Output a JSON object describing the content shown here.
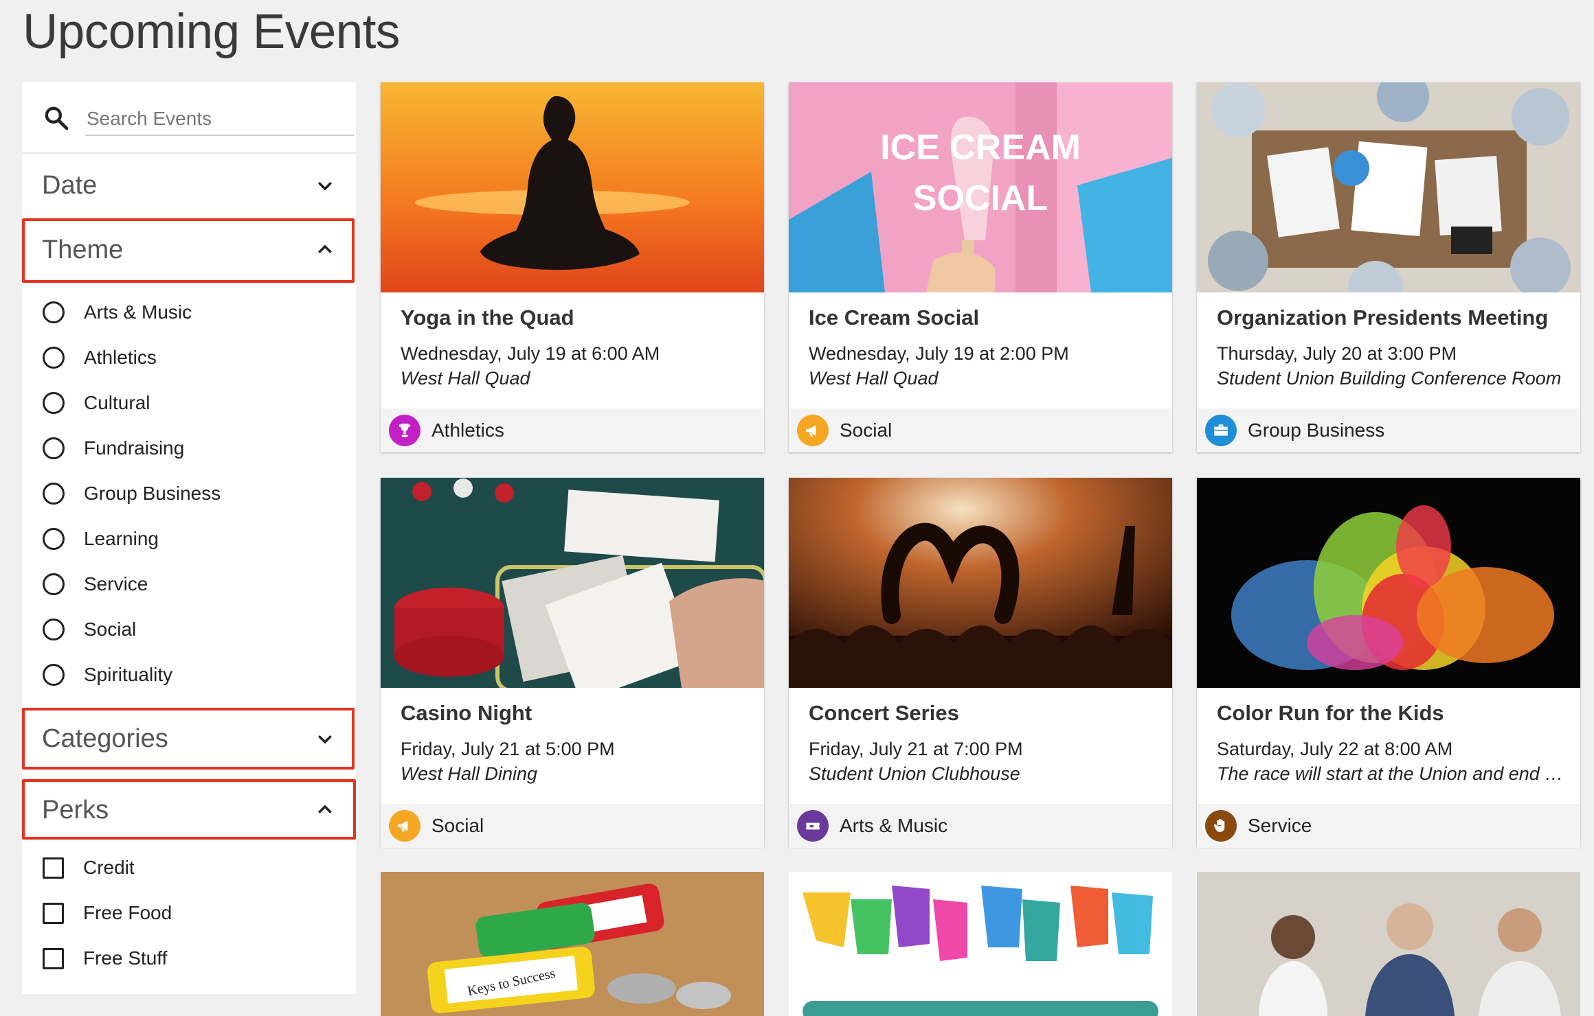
{
  "page": {
    "title": "Upcoming Events"
  },
  "search": {
    "placeholder": "Search Events",
    "value": ""
  },
  "filters": {
    "date": {
      "label": "Date",
      "expanded": false
    },
    "theme": {
      "label": "Theme",
      "expanded": true,
      "options": [
        "Arts & Music",
        "Athletics",
        "Cultural",
        "Fundraising",
        "Group Business",
        "Learning",
        "Service",
        "Social",
        "Spirituality"
      ]
    },
    "categories": {
      "label": "Categories",
      "expanded": false
    },
    "perks": {
      "label": "Perks",
      "expanded": true,
      "options": [
        "Credit",
        "Free Food",
        "Free Stuff"
      ]
    }
  },
  "colors": {
    "highlight": "#e53323",
    "athletics": "#c21fc4",
    "social": "#f5a623",
    "group_business": "#1e8fd6",
    "arts_music": "#6a3a9a",
    "service": "#8a4a0f"
  },
  "events": [
    {
      "title": "Yoga in the Quad",
      "when": "Wednesday, July 19 at 6:00 AM",
      "where": "West Hall Quad",
      "theme": "Athletics",
      "icon": "trophy-icon"
    },
    {
      "title": "Ice Cream Social",
      "when": "Wednesday, July 19 at 2:00 PM",
      "where": "West Hall Quad",
      "theme": "Social",
      "icon": "megaphone-icon",
      "image_text": "ICE CREAM SOCIAL"
    },
    {
      "title": "Organization Presidents Meeting",
      "when": "Thursday, July 20 at 3:00 PM",
      "where": "Student Union Building Conference Room",
      "theme": "Group Business",
      "icon": "briefcase-icon"
    },
    {
      "title": "Casino Night",
      "when": "Friday, July 21 at 5:00 PM",
      "where": "West Hall Dining",
      "theme": "Social",
      "icon": "megaphone-icon"
    },
    {
      "title": "Concert Series",
      "when": "Friday, July 21 at 7:00 PM",
      "where": "Student Union Clubhouse",
      "theme": "Arts & Music",
      "icon": "ticket-icon"
    },
    {
      "title": "Color Run for the Kids",
      "when": "Saturday, July 22 at 8:00 AM",
      "where": "The race will start at the Union and end at the park",
      "theme": "Service",
      "icon": "hand-icon"
    }
  ],
  "partial_cards": [
    {
      "image_text": "Keys to Success"
    },
    {
      "image_text": ""
    },
    {
      "image_text": ""
    }
  ]
}
